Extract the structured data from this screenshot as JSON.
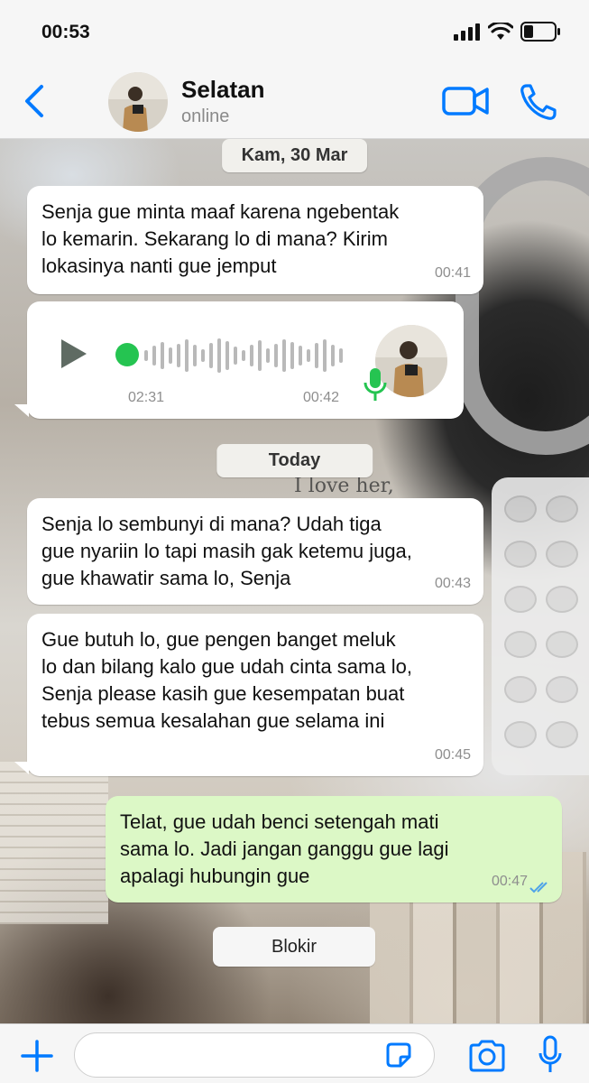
{
  "status_bar": {
    "time": "00:53"
  },
  "header": {
    "name": "Selatan",
    "status": "online"
  },
  "dates": {
    "first": "Kam, 30 Mar",
    "today": "Today"
  },
  "messages": [
    {
      "text": "Senja gue minta maaf karena ngebentak\nlo kemarin. Sekarang lo di mana? Kirim\nlokasinya nanti gue jemput",
      "time": "00:41"
    },
    {
      "text": "Senja lo sembunyi di mana? Udah tiga\ngue nyariin lo tapi masih gak ketemu juga,\ngue khawatir sama lo, Senja",
      "time": "00:43"
    },
    {
      "text": "Gue butuh lo, gue pengen banget meluk\nlo dan bilang kalo gue udah cinta sama lo,\nSenja please kasih gue kesempatan buat\ntebus semua kesalahan gue selama ini",
      "time": "00:45"
    },
    {
      "text": "Telat, gue udah benci setengah mati\nsama lo. Jadi jangan ganggu gue lagi\napalagi hubungin gue",
      "time": "00:47"
    }
  ],
  "voice_note": {
    "duration": "02:31",
    "time": "00:42"
  },
  "block_label": "Blokir",
  "input": {
    "value": "",
    "placeholder": ""
  },
  "colors": {
    "accent": "#007aff",
    "outgoing": "#dcf8c6",
    "voice_dot": "#25c451",
    "mic": "#25c451"
  },
  "icons": {
    "back": "chevron-left-icon",
    "video": "video-camera-icon",
    "call": "phone-icon",
    "plus": "plus-icon",
    "sticker": "sticker-icon",
    "camera": "camera-icon",
    "mic": "microphone-icon",
    "read": "double-check-icon"
  }
}
